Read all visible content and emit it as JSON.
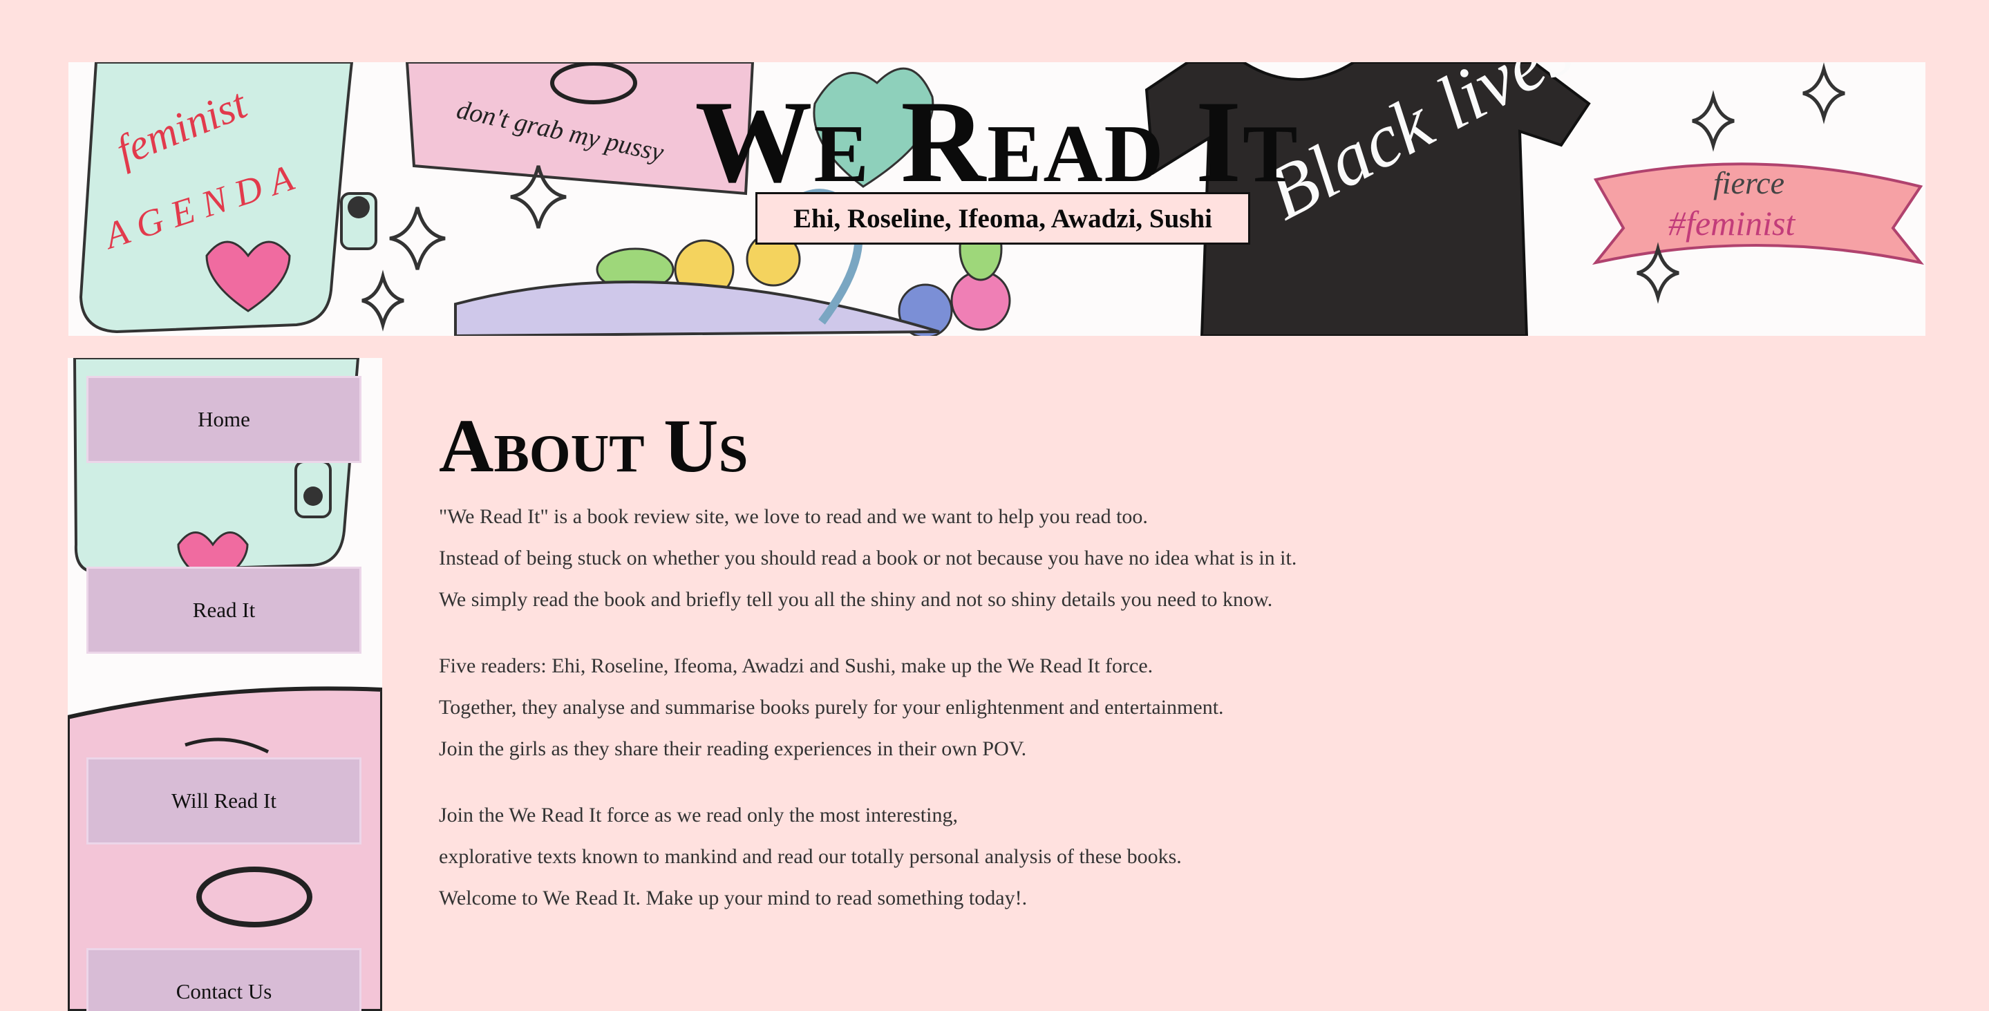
{
  "header": {
    "title": "We Read It",
    "authors": "Ehi, Roseline, Ifeoma, Awadzi, Sushi",
    "art_text": {
      "feminist": "feminist",
      "agenda": "AGENDA",
      "dont_grab": "don't grab my pussy",
      "black_lives": "Black lives",
      "fierce": "fierce",
      "hashtag_feminist": "#feminist"
    }
  },
  "sidebar": {
    "items": [
      {
        "label": "Home"
      },
      {
        "label": "Read It"
      },
      {
        "label": "Will Read It"
      },
      {
        "label": "Contact Us"
      }
    ]
  },
  "main": {
    "heading": "About Us",
    "paragraphs": [
      [
        "\"We Read It\" is a book review site, we love to read and we want to help you read too.",
        "Instead of being stuck on whether you should read a book or not because you have no idea what is in it.",
        "We simply read the book and briefly tell you all the shiny and not so shiny details you need to know."
      ],
      [
        "Five readers: Ehi, Roseline, Ifeoma, Awadzi and Sushi, make up the We Read It force.",
        "Together, they analyse and summarise books purely for your enlightenment and entertainment.",
        "Join the girls as they share their reading experiences in their own POV."
      ],
      [
        "Join the We Read It force as we read only the most interesting,",
        "explorative texts known to mankind and read our totally personal analysis of these books.",
        "Welcome to We Read It. Make up your mind to read something today!."
      ]
    ]
  },
  "colors": {
    "page_bg": "#ffe1df",
    "nav_button": "#d8bcd6",
    "text": "#333333",
    "heading": "#0b0b0b"
  }
}
